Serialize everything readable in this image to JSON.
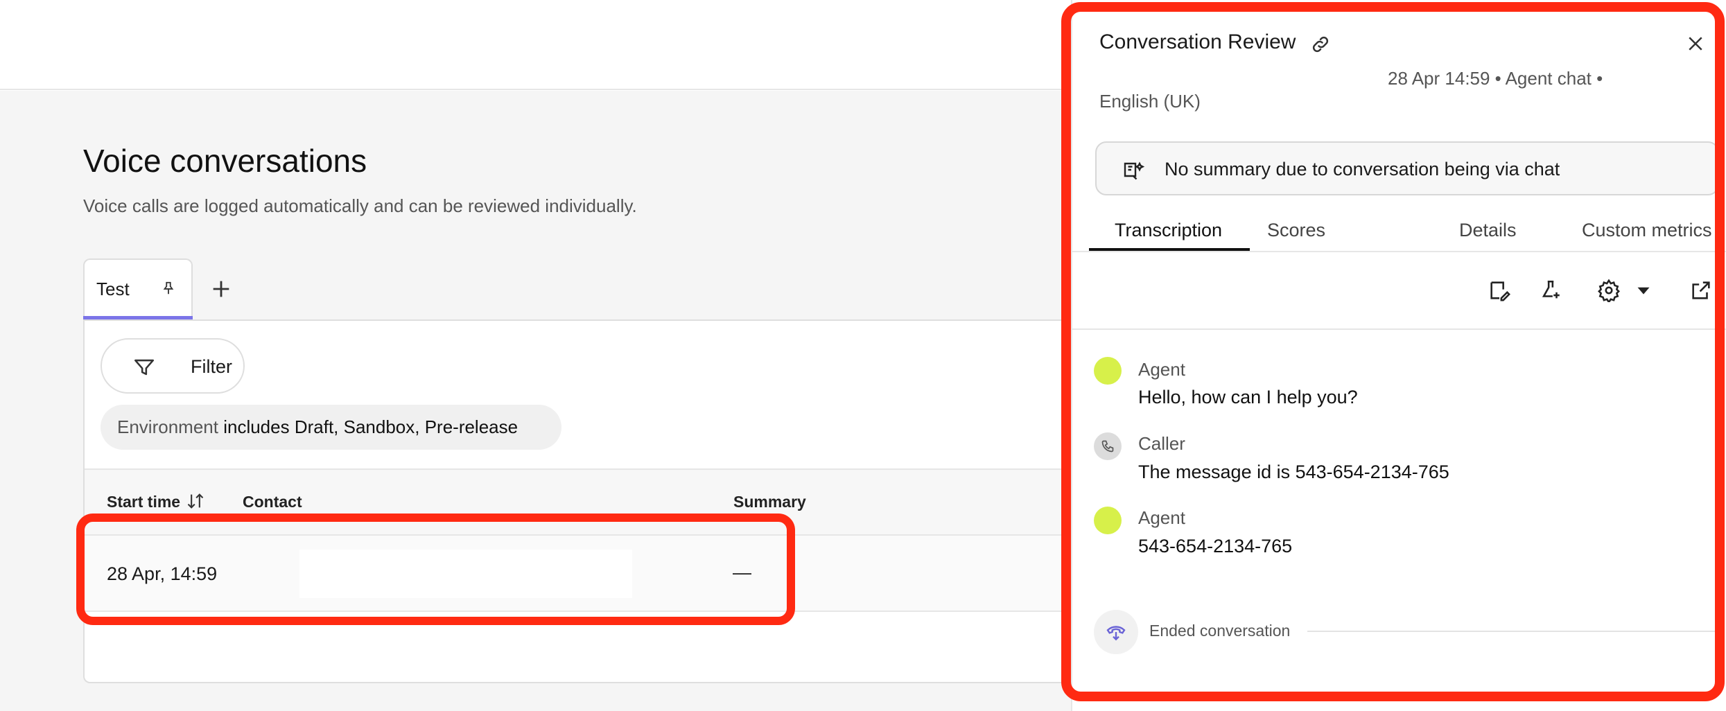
{
  "page": {
    "title": "Voice conversations",
    "subtitle": "Voice calls are logged automatically and can be reviewed individually."
  },
  "tabs": {
    "active_label": "Test",
    "pin_icon": "pin-icon",
    "add_icon": "plus-icon"
  },
  "filter": {
    "button_label": "Filter",
    "icon": "funnel-icon",
    "chip_key": "Environment",
    "chip_value": "includes Draft, Sandbox, Pre-release"
  },
  "table": {
    "columns": [
      "Start time",
      "Contact",
      "Summary"
    ],
    "sort_icon": "sort-arrows-icon",
    "rows": [
      {
        "start_time": "28 Apr, 14:59",
        "contact": "",
        "summary": "—"
      }
    ]
  },
  "drawer": {
    "title": "Conversation Review",
    "meta_line1": "28 Apr 14:59 • Agent chat •",
    "meta_line2": "English (UK)",
    "summary_text": "No summary due to conversation being via chat",
    "tabs": [
      "Transcription",
      "Scores",
      "Details",
      "Custom metrics"
    ],
    "active_tab": "Transcription",
    "tools": [
      "edit-note-icon",
      "flask-add-icon",
      "gear-icon",
      "caret-down-icon",
      "external-link-icon"
    ],
    "messages": [
      {
        "sender": "Agent",
        "text": "Hello, how can I help you?"
      },
      {
        "sender": "Caller",
        "text": "The message id is 543-654-2134-765"
      },
      {
        "sender": "Agent",
        "text": "543-654-2134-765"
      }
    ],
    "end_label": "Ended conversation"
  },
  "colors": {
    "highlight": "#ff2a12",
    "tab_accent": "#7b74e8",
    "agent_avatar": "#d7f04a"
  }
}
